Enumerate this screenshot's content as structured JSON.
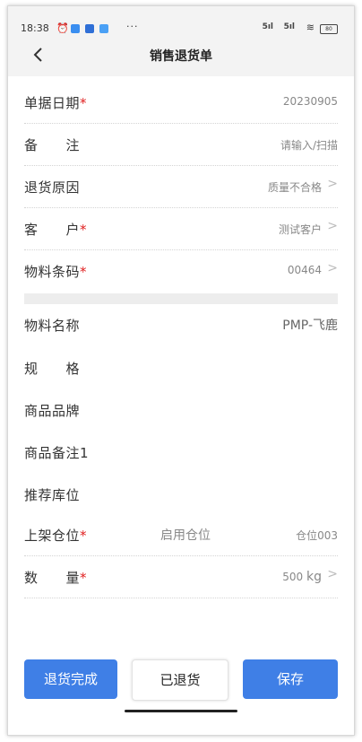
{
  "status_bar": {
    "time": "18:38",
    "more": "···",
    "signal1": "5ıl",
    "signal2": "5ıl",
    "battery": "80"
  },
  "header": {
    "title": "销售退货单"
  },
  "fields": [
    {
      "label": "单据日期",
      "required": true,
      "value": "20230905",
      "arrow": false
    },
    {
      "label": "备　　注",
      "required": false,
      "value": "请输入/扫描",
      "arrow": false
    },
    {
      "label": "退货原因",
      "required": false,
      "value": "质量不合格",
      "arrow": true
    },
    {
      "label": "客　　户",
      "required": true,
      "value": "测试客户",
      "arrow": true
    },
    {
      "label": "物料条码",
      "required": true,
      "value": "00464",
      "arrow": true
    }
  ],
  "info": [
    {
      "label": "物料名称",
      "value": "PMP-飞鹿"
    },
    {
      "label": "规　　格",
      "value": ""
    },
    {
      "label": "商品品牌",
      "value": ""
    },
    {
      "label": "商品备注1",
      "value": ""
    },
    {
      "label": "推荐库位",
      "value": ""
    }
  ],
  "shelf": {
    "label": "上架仓位",
    "required": true,
    "enable_label": "启用仓位",
    "value": "仓位003"
  },
  "quantity": {
    "label": "数　　量",
    "required": true,
    "value": "500",
    "unit": "kg"
  },
  "req_mark": "*",
  "arrow_glyph": ">",
  "buttons": {
    "complete": "退货完成",
    "returned": "已退货",
    "save": "保存"
  },
  "colors": {
    "primary": "#3f7fe6",
    "required": "#e02020"
  }
}
